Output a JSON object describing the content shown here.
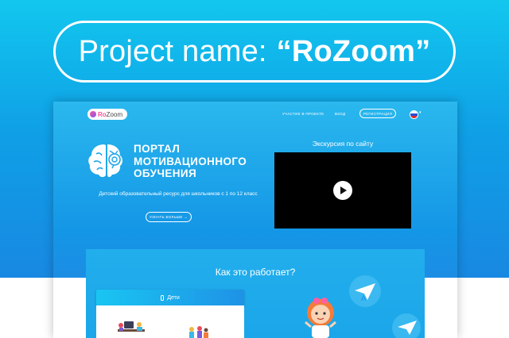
{
  "banner": {
    "prefix": "Project name:",
    "project_name": "“RoZoom”"
  },
  "site": {
    "logo": {
      "text_pre": "Ro",
      "text_post": "Zoom"
    },
    "nav": {
      "participate": "УЧАСТИЕ В ПРОЕКТЕ",
      "login": "ВХОД",
      "register": "РЕГИСТРАЦИЯ",
      "language_flag": "russia-flag-icon"
    },
    "hero": {
      "title_lines": [
        "ПОРТАЛ",
        "МОТИВАЦИОННОГО",
        "ОБУЧЕНИЯ"
      ],
      "subtitle": "Детский образовательный ресурс для школьников с 1 по 12 класс",
      "more_button": "УЗНАТЬ БОЛЬШЕ →"
    },
    "video": {
      "label": "Экскурсия по сайту"
    },
    "how_it_works": {
      "title": "Как это работает?",
      "tab_kids": "Дети"
    }
  },
  "colors": {
    "background_top": "#12c7ee",
    "background_bottom": "#1c7fe0",
    "logo_accent": "#ff4f9a",
    "video_bg": "#000000"
  }
}
